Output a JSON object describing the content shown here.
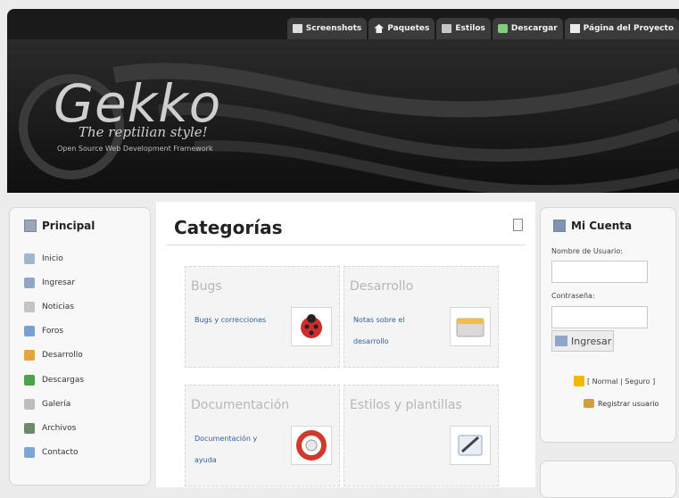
{
  "topnav": {
    "items": [
      {
        "label": "Screenshots",
        "icon": "camera-icon"
      },
      {
        "label": "Paquetes",
        "icon": "package-icon"
      },
      {
        "label": "Estilos",
        "icon": "styles-icon"
      },
      {
        "label": "Descargar",
        "icon": "download-icon"
      },
      {
        "label": "Página del Proyecto",
        "icon": "page-icon"
      }
    ]
  },
  "banner": {
    "logo": "Gekko",
    "tagline": "The reptilian style!",
    "subline": "Open Source Web Development Framework"
  },
  "sidebar": {
    "title": "Principal",
    "items": [
      {
        "label": "Inicio",
        "icon": "home-icon"
      },
      {
        "label": "Ingresar",
        "icon": "login-icon"
      },
      {
        "label": "Noticias",
        "icon": "news-icon"
      },
      {
        "label": "Foros",
        "icon": "forums-icon"
      },
      {
        "label": "Desarrollo",
        "icon": "development-icon"
      },
      {
        "label": "Descargas",
        "icon": "downloads-icon"
      },
      {
        "label": "Galería",
        "icon": "gallery-icon"
      },
      {
        "label": "Archivos",
        "icon": "files-icon"
      },
      {
        "label": "Contacto",
        "icon": "contact-icon"
      }
    ]
  },
  "main": {
    "title": "Categorías",
    "cards": [
      {
        "title": "Bugs",
        "link": "Bugs y correcciones",
        "thumb": "ladybug-icon"
      },
      {
        "title": "Desarrollo",
        "link": "Notas sobre el desarrollo",
        "thumb": "notes-icon"
      },
      {
        "title": "Documentación",
        "link": "Documentación y ayuda",
        "thumb": "help-icon"
      },
      {
        "title": "Estilos y plantillas",
        "link": "",
        "thumb": "templates-icon"
      }
    ]
  },
  "account": {
    "title": "Mi Cuenta",
    "username_label": "Nombre de Usuario:",
    "username_value": "",
    "password_label": "Contraseña:",
    "password_value": "",
    "submit_label": "Ingresar",
    "mode_text": "[ Normal | Seguro ]",
    "register_label": "Registrar usuario"
  }
}
